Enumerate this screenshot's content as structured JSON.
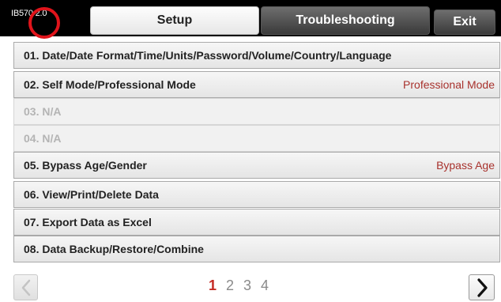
{
  "header": {
    "version": "IB570 2.0",
    "tabs": [
      {
        "label": "Setup"
      },
      {
        "label": "Troubleshooting"
      },
      {
        "label": "Exit"
      }
    ]
  },
  "menu": {
    "items": [
      {
        "label": "01. Date/Date Format/Time/Units/Password/Volume/Country/Language",
        "value": "",
        "enabled": true
      },
      {
        "label": "02. Self Mode/Professional Mode",
        "value": "Professional Mode",
        "enabled": true
      },
      {
        "label": "03. N/A",
        "value": "",
        "enabled": false
      },
      {
        "label": "04. N/A",
        "value": "",
        "enabled": false
      },
      {
        "label": "05. Bypass Age/Gender",
        "value": "Bypass Age",
        "enabled": true
      },
      {
        "label": "06. View/Print/Delete Data",
        "value": "",
        "enabled": true
      },
      {
        "label": "07. Export Data as Excel",
        "value": "",
        "enabled": true
      },
      {
        "label": "08. Data Backup/Restore/Combine",
        "value": "",
        "enabled": true
      }
    ]
  },
  "pagination": {
    "current": "1",
    "pages": [
      "1",
      "2",
      "3",
      "4"
    ]
  },
  "colors": {
    "value_text": "#a8322d",
    "active_page": "#c42a23",
    "highlight_circle": "#e0141b"
  }
}
